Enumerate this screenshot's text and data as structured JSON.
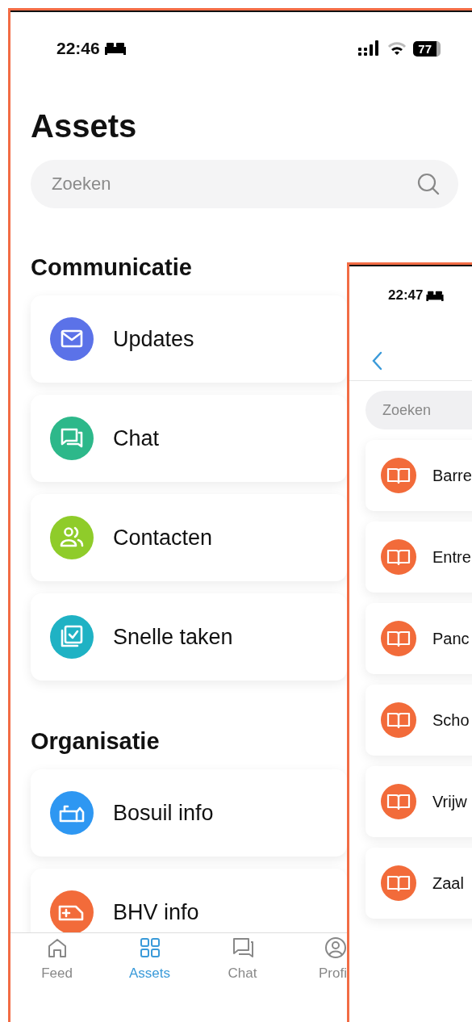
{
  "main_screen": {
    "status_bar": {
      "time": "22:46",
      "battery": "77"
    },
    "title": "Assets",
    "search": {
      "placeholder": "Zoeken"
    },
    "sections": [
      {
        "title": "Communicatie",
        "items": [
          {
            "label": "Updates",
            "kind": "envelope",
            "color": "#5b72e8"
          },
          {
            "label": "Chat",
            "kind": "chat",
            "color": "#2db88a"
          },
          {
            "label": "Contacten",
            "kind": "people",
            "color": "#8fcc2a"
          },
          {
            "label": "Snelle taken",
            "kind": "tasks",
            "color": "#1fb2c4"
          }
        ]
      },
      {
        "title": "Organisatie",
        "items": [
          {
            "label": "Bosuil info",
            "kind": "building",
            "color": "#2e97f2"
          },
          {
            "label": "BHV info",
            "kind": "ambulance",
            "color": "#f26b3a"
          }
        ]
      }
    ],
    "tab_bar": [
      {
        "label": "Feed",
        "kind": "home",
        "selected": false
      },
      {
        "label": "Assets",
        "kind": "grid",
        "selected": true
      },
      {
        "label": "Chat",
        "kind": "chat",
        "selected": false
      },
      {
        "label": "Profi",
        "kind": "profile",
        "selected": false
      }
    ]
  },
  "detail_screen": {
    "status_bar": {
      "time": "22:47"
    },
    "search": {
      "placeholder": "Zoeken"
    },
    "items": [
      {
        "label": "Barre",
        "kind": "book",
        "color": "#f26b3a"
      },
      {
        "label": "Entre",
        "kind": "book",
        "color": "#f26b3a"
      },
      {
        "label": "Panc",
        "kind": "book",
        "color": "#f26b3a"
      },
      {
        "label": "Scho",
        "kind": "book",
        "color": "#f26b3a"
      },
      {
        "label": "Vrijw",
        "kind": "book",
        "color": "#f26b3a"
      },
      {
        "label": "Zaal",
        "kind": "book",
        "color": "#f26b3a"
      }
    ]
  }
}
